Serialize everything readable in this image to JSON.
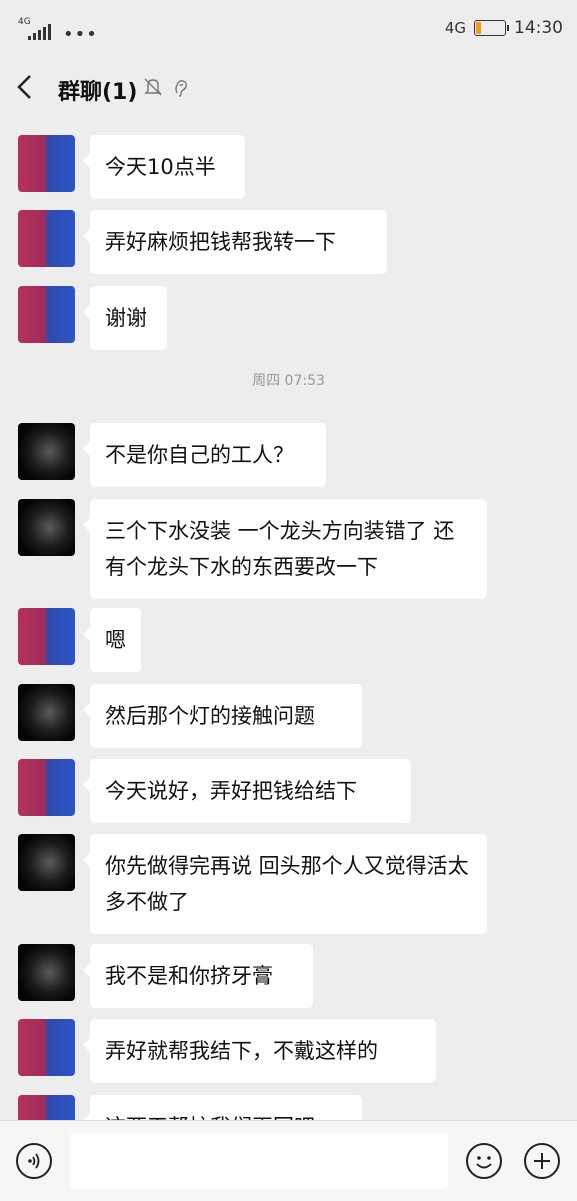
{
  "status_bar": {
    "network_left": "4G",
    "dots": "•••",
    "network_right": "4G",
    "time": "14:30",
    "battery_level": 0.15,
    "battery_color": "#f39c12"
  },
  "header": {
    "back_icon": "chevron-left",
    "title": "群聊(1)",
    "mute_icon": "bell-off",
    "ear_icon": "ear"
  },
  "timestamp": "周四 07:53",
  "messages": [
    {
      "avatar": "flower",
      "text": "今天10点半"
    },
    {
      "avatar": "flower",
      "text": "弄好麻烦把钱帮我转一下"
    },
    {
      "avatar": "flower",
      "text": "谢谢"
    },
    {
      "avatar": "dark",
      "text": "不是你自己的工人？"
    },
    {
      "avatar": "dark",
      "text": "三个下水没装 一个龙头方向装错了 还有个龙头下水的东西要改一下"
    },
    {
      "avatar": "flower",
      "text": "嗯"
    },
    {
      "avatar": "dark",
      "text": "然后那个灯的接触问题"
    },
    {
      "avatar": "flower",
      "text": "今天说好，弄好把钱给结下"
    },
    {
      "avatar": "dark",
      "text": "你先做得完再说 回头那个人又觉得活太多不做了"
    },
    {
      "avatar": "dark",
      "text": "我不是和你挤牙膏"
    },
    {
      "avatar": "flower",
      "text": "弄好就帮我结下，不戴这样的"
    },
    {
      "avatar": "flower",
      "text": "这两天帮忙我们再回吧"
    }
  ],
  "input_bar": {
    "voice_icon": "voice",
    "emoji_icon": "smiley",
    "plus_icon": "plus",
    "value": ""
  }
}
